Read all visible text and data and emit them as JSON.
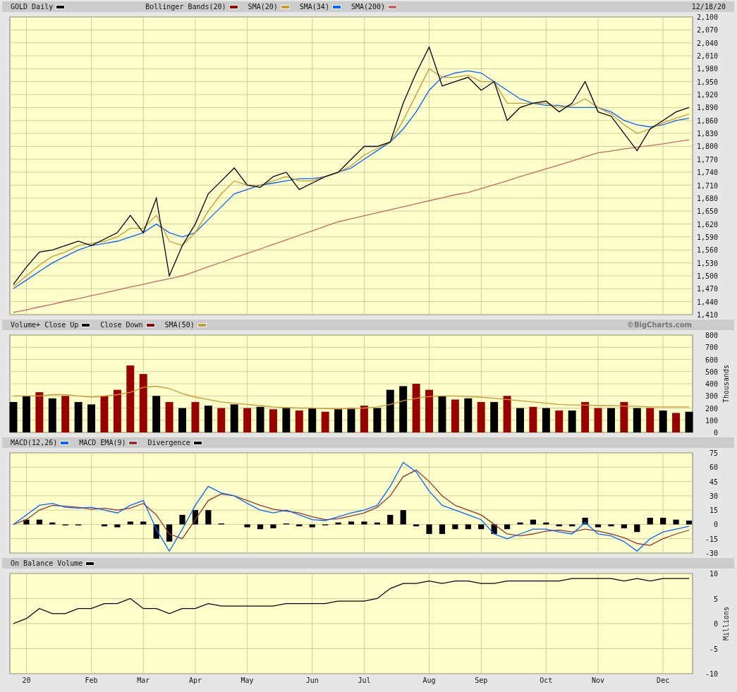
{
  "panels": [
    {
      "legend_extra": [
        {
          "label": "Bollinger Bands(20)",
          "color": "#990000"
        }
      ],
      "note": "12/18/20",
      "chart_data": {
        "type": "line",
        "grid": true,
        "ylim": [
          1410,
          2100
        ],
        "yticks": [
          {
            "value": 1410,
            "label": "1,410"
          },
          {
            "value": 1440,
            "label": "1,440"
          },
          {
            "value": 1470,
            "label": "1,470"
          },
          {
            "value": 1500,
            "label": "1,500"
          },
          {
            "value": 1530,
            "label": "1,530"
          },
          {
            "value": 1560,
            "label": "1,560"
          },
          {
            "value": 1590,
            "label": "1,590"
          },
          {
            "value": 1620,
            "label": "1,620"
          },
          {
            "value": 1650,
            "label": "1,650"
          },
          {
            "value": 1680,
            "label": "1,680"
          },
          {
            "value": 1710,
            "label": "1,710"
          },
          {
            "value": 1740,
            "label": "1,740"
          },
          {
            "value": 1770,
            "label": "1,770"
          },
          {
            "value": 1800,
            "label": "1,800"
          },
          {
            "value": 1830,
            "label": "1,830"
          },
          {
            "value": 1860,
            "label": "1,860"
          },
          {
            "value": 1890,
            "label": "1,890"
          },
          {
            "value": 1920,
            "label": "1,920"
          },
          {
            "value": 1950,
            "label": "1,950"
          },
          {
            "value": 1980,
            "label": "1,980"
          },
          {
            "value": 2010,
            "label": "2,010"
          },
          {
            "value": 2040,
            "label": "2,040"
          },
          {
            "value": 2070,
            "label": "2,070"
          },
          {
            "value": 2100,
            "label": "2,100"
          }
        ],
        "series": [
          {
            "name": "GOLD Daily",
            "color": "#000000",
            "type": "line",
            "values": [
              1480,
              1520,
              1555,
              1560,
              1570,
              1580,
              1570,
              1585,
              1600,
              1640,
              1600,
              1680,
              1500,
              1570,
              1620,
              1690,
              1720,
              1750,
              1710,
              1705,
              1730,
              1740,
              1700,
              1715,
              1730,
              1740,
              1770,
              1800,
              1800,
              1810,
              1900,
              1970,
              2030,
              1940,
              1950,
              1960,
              1930,
              1950,
              1860,
              1890,
              1900,
              1905,
              1880,
              1900,
              1950,
              1880,
              1870,
              1830,
              1790,
              1840,
              1860,
              1880,
              1890
            ]
          },
          {
            "name": "SMA(20)",
            "color": "#cc9933",
            "type": "line",
            "values": [
              1475,
              1500,
              1525,
              1545,
              1555,
              1570,
              1575,
              1580,
              1590,
              1610,
              1610,
              1640,
              1580,
              1570,
              1600,
              1650,
              1690,
              1720,
              1710,
              1710,
              1720,
              1730,
              1720,
              1720,
              1730,
              1740,
              1755,
              1780,
              1795,
              1810,
              1860,
              1920,
              1980,
              1960,
              1960,
              1965,
              1950,
              1950,
              1900,
              1900,
              1900,
              1900,
              1890,
              1895,
              1910,
              1890,
              1875,
              1850,
              1830,
              1840,
              1855,
              1865,
              1875
            ]
          },
          {
            "name": "SMA(34)",
            "color": "#0066ff",
            "type": "line",
            "values": [
              1470,
              1490,
              1510,
              1530,
              1545,
              1560,
              1570,
              1575,
              1580,
              1590,
              1600,
              1620,
              1600,
              1590,
              1600,
              1630,
              1660,
              1690,
              1700,
              1710,
              1715,
              1720,
              1725,
              1725,
              1730,
              1740,
              1750,
              1770,
              1790,
              1810,
              1840,
              1880,
              1930,
              1960,
              1970,
              1975,
              1970,
              1950,
              1930,
              1910,
              1900,
              1895,
              1895,
              1890,
              1890,
              1890,
              1880,
              1860,
              1850,
              1845,
              1850,
              1860,
              1865
            ]
          },
          {
            "name": "SMA(200)",
            "color": "#cc6666",
            "type": "line",
            "values": [
              1415,
              1421,
              1428,
              1434,
              1441,
              1447,
              1454,
              1460,
              1467,
              1474,
              1480,
              1487,
              1493,
              1500,
              1510,
              1521,
              1531,
              1542,
              1552,
              1562,
              1573,
              1583,
              1594,
              1604,
              1615,
              1625,
              1632,
              1639,
              1646,
              1653,
              1660,
              1667,
              1674,
              1681,
              1688,
              1693,
              1702,
              1711,
              1720,
              1730,
              1739,
              1748,
              1757,
              1766,
              1776,
              1785,
              1789,
              1794,
              1798,
              1802,
              1806,
              1811,
              1815
            ]
          }
        ]
      }
    },
    {
      "note": "©BigCharts.com",
      "chart_data": {
        "type": "bar",
        "grid": true,
        "stacked": true,
        "ylabel": "Thousands",
        "ylim": [
          0,
          800
        ],
        "yticks": [
          0,
          100,
          200,
          300,
          400,
          500,
          600,
          700,
          800
        ],
        "series": [
          {
            "name": "Volume+ Close Up",
            "color": "#000000",
            "type": "bar",
            "values": [
              250,
              300,
              0,
              280,
              0,
              250,
              230,
              0,
              0,
              0,
              0,
              300,
              0,
              200,
              0,
              220,
              0,
              230,
              0,
              210,
              0,
              200,
              0,
              200,
              0,
              190,
              200,
              0,
              200,
              350,
              380,
              0,
              0,
              300,
              0,
              280,
              0,
              250,
              0,
              200,
              0,
              200,
              0,
              180,
              0,
              0,
              200,
              0,
              200,
              0,
              180,
              0,
              170
            ]
          },
          {
            "name": "Close Down",
            "color": "#990000",
            "type": "bar",
            "values": [
              0,
              0,
              330,
              0,
              300,
              0,
              0,
              300,
              350,
              550,
              480,
              0,
              250,
              0,
              250,
              0,
              200,
              0,
              200,
              0,
              190,
              0,
              180,
              0,
              170,
              0,
              0,
              220,
              0,
              0,
              0,
              400,
              350,
              0,
              270,
              0,
              250,
              0,
              300,
              0,
              210,
              0,
              180,
              0,
              250,
              200,
              0,
              250,
              0,
              200,
              0,
              160,
              0
            ]
          },
          {
            "name": "SMA(50)",
            "color": "#cc9933",
            "type": "line",
            "values": [
              300,
              300,
              300,
              310,
              310,
              300,
              290,
              300,
              310,
              330,
              370,
              380,
              360,
              320,
              290,
              270,
              250,
              240,
              230,
              220,
              210,
              205,
              200,
              200,
              195,
              195,
              195,
              200,
              210,
              230,
              260,
              280,
              295,
              300,
              300,
              295,
              290,
              280,
              270,
              260,
              250,
              240,
              230,
              225,
              225,
              220,
              220,
              215,
              215,
              210,
              210,
              210,
              210
            ]
          }
        ]
      }
    },
    {
      "chart_data": {
        "type": "line",
        "grid": true,
        "ylim": [
          -30,
          75
        ],
        "yticks": [
          -30,
          -15,
          0,
          15,
          30,
          45,
          60,
          75
        ],
        "series": [
          {
            "name": "MACD(12,26)",
            "color": "#0066ff",
            "type": "line",
            "values": [
              0,
              10,
              20,
              22,
              18,
              17,
              18,
              15,
              12,
              20,
              25,
              -5,
              -28,
              -5,
              20,
              40,
              33,
              30,
              22,
              15,
              12,
              15,
              10,
              5,
              4,
              8,
              12,
              15,
              20,
              40,
              65,
              55,
              35,
              20,
              15,
              10,
              5,
              -10,
              -15,
              -10,
              -5,
              -5,
              -8,
              -10,
              2,
              -10,
              -12,
              -18,
              -28,
              -15,
              -8,
              -5,
              -2
            ]
          },
          {
            "name": "MACD EMA(9)",
            "color": "#993333",
            "type": "line",
            "values": [
              0,
              5,
              15,
              20,
              19,
              18,
              16,
              17,
              15,
              17,
              22,
              10,
              -10,
              -15,
              5,
              25,
              32,
              30,
              25,
              20,
              16,
              14,
              12,
              8,
              5,
              6,
              9,
              12,
              18,
              30,
              50,
              57,
              45,
              30,
              20,
              15,
              10,
              0,
              -10,
              -12,
              -10,
              -7,
              -6,
              -8,
              -5,
              -7,
              -10,
              -14,
              -20,
              -22,
              -15,
              -10,
              -6
            ]
          },
          {
            "name": "Divergence",
            "color": "#000000",
            "type": "bar",
            "values": [
              0,
              5,
              5,
              2,
              -1,
              -1,
              0,
              -2,
              -3,
              3,
              3,
              -15,
              -18,
              10,
              15,
              15,
              1,
              0,
              -3,
              -5,
              -4,
              1,
              -2,
              -3,
              -1,
              2,
              3,
              3,
              2,
              10,
              15,
              -2,
              -10,
              -10,
              -5,
              -5,
              -5,
              -10,
              -5,
              2,
              5,
              2,
              -2,
              -2,
              7,
              -3,
              -2,
              -4,
              -8,
              7,
              7,
              5,
              4
            ]
          }
        ]
      }
    },
    {
      "chart_data": {
        "type": "line",
        "grid": true,
        "ylabel": "Millions",
        "ylim": [
          -10,
          10
        ],
        "yticks": [
          -10,
          -5,
          0,
          5,
          10
        ],
        "categories": [
          null,
          "20",
          null,
          null,
          null,
          null,
          "Feb",
          null,
          null,
          null,
          "Mar",
          null,
          null,
          null,
          "Apr",
          null,
          null,
          null,
          "May",
          null,
          null,
          null,
          null,
          "Jun",
          null,
          null,
          null,
          "Jul",
          null,
          null,
          null,
          null,
          "Aug",
          null,
          null,
          null,
          "Sep",
          null,
          null,
          null,
          null,
          "Oct",
          null,
          null,
          null,
          "Nov",
          null,
          null,
          null,
          null,
          "Dec",
          null,
          null
        ],
        "series": [
          {
            "name": "On Balance Volume",
            "color": "#000000",
            "type": "line",
            "values": [
              0,
              1,
              3,
              2,
              2,
              3,
              3,
              4,
              4,
              5,
              3,
              3,
              2,
              3,
              3,
              4,
              3.5,
              3.5,
              3.5,
              3.5,
              3.5,
              4,
              4,
              4,
              4,
              4.5,
              4.5,
              4.5,
              5,
              7,
              8,
              8,
              8.5,
              8,
              8.5,
              8.5,
              8,
              8,
              8.5,
              8.5,
              8.5,
              8.5,
              8.5,
              9,
              9,
              9,
              9,
              8.5,
              9,
              8.5,
              9,
              9,
              9
            ]
          }
        ]
      }
    }
  ]
}
